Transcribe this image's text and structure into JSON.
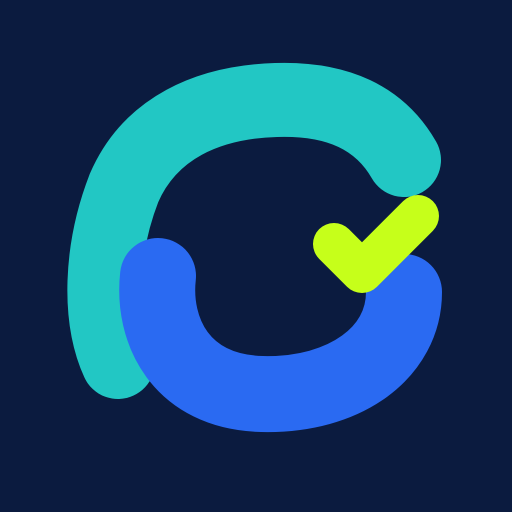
{
  "logo": {
    "name": "app-logo",
    "colors": {
      "background": "#0b1b3f",
      "teal_arc": "#22c7c4",
      "blue_arc": "#2a6af2",
      "check": "#c6ff1a"
    },
    "icon": "refresh-check-icon"
  }
}
